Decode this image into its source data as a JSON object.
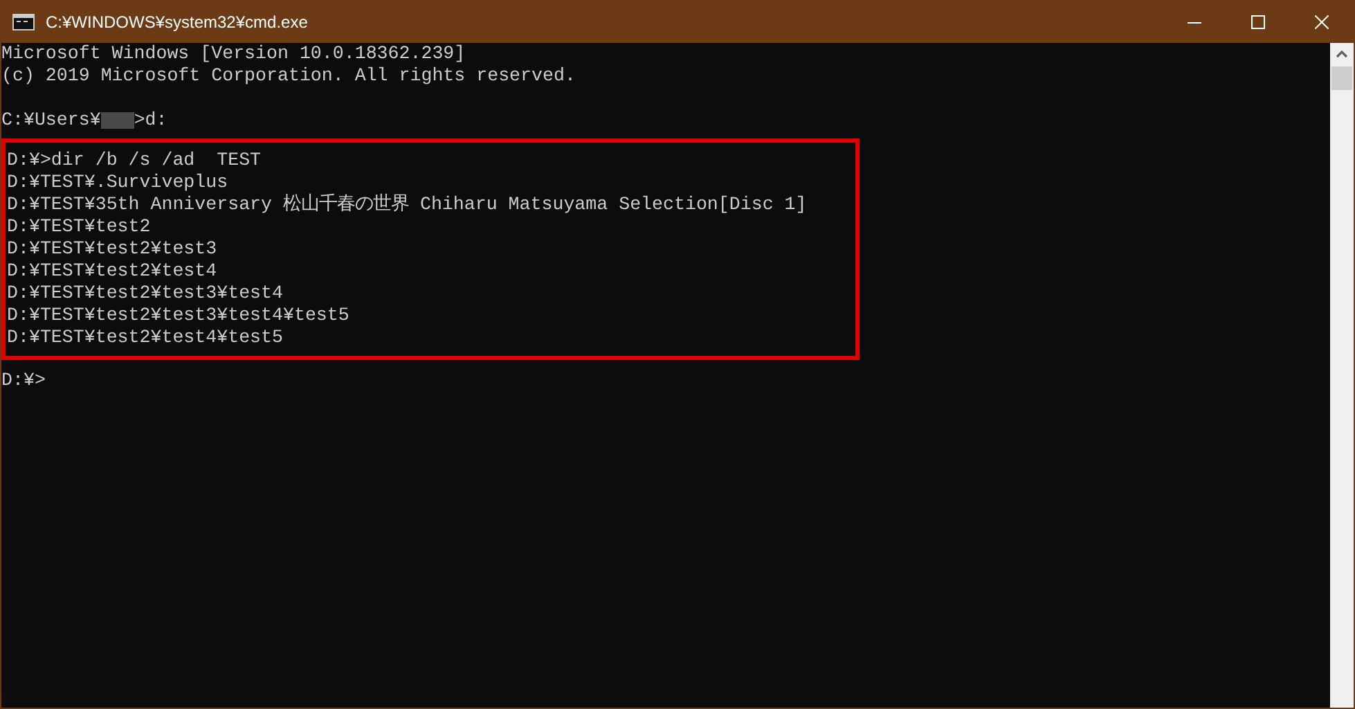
{
  "window": {
    "title": "C:¥WINDOWS¥system32¥cmd.exe"
  },
  "console": {
    "header_lines": [
      "Microsoft Windows [Version 10.0.18362.239]",
      "(c) 2019 Microsoft Corporation. All rights reserved."
    ],
    "user_prompt": {
      "before": "C:¥Users¥",
      "after": ">d:"
    },
    "highlighted_lines": [
      "D:¥>dir /b /s /ad  TEST",
      "D:¥TEST¥.Surviveplus",
      "D:¥TEST¥35th Anniversary 松山千春の世界 Chiharu Matsuyama Selection[Disc 1]",
      "D:¥TEST¥test2",
      "D:¥TEST¥test2¥test3",
      "D:¥TEST¥test2¥test4",
      "D:¥TEST¥test2¥test3¥test4",
      "D:¥TEST¥test2¥test3¥test4¥test5",
      "D:¥TEST¥test2¥test4¥test5"
    ],
    "final_prompt": "D:¥>"
  }
}
